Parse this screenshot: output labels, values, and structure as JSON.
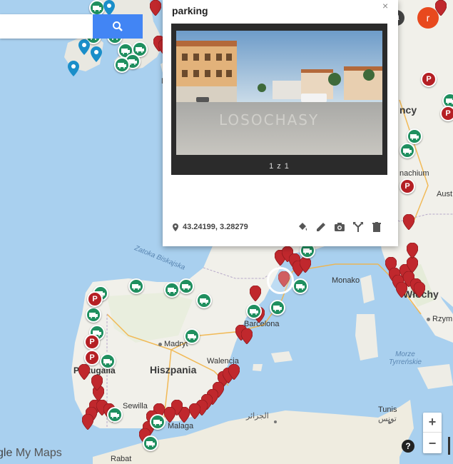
{
  "search": {
    "placeholder": "",
    "button_icon": "search-icon"
  },
  "topbar": {
    "apps_icon": "apps-grid-icon",
    "notifications_icon": "bell-icon",
    "avatar_letter": "r"
  },
  "popup": {
    "title": "parking",
    "close_label": "×",
    "photo_counter": "1 z 1",
    "photo_watermark": "LOSOCHASY",
    "coordinates": "43.24199, 3.28279",
    "tools": [
      "paint-bucket-icon",
      "pencil-icon",
      "camera-icon",
      "directions-icon",
      "trash-icon"
    ]
  },
  "map": {
    "labels": {
      "spain": "Hiszpania",
      "italy": "Włochy",
      "portugal": "Portugalia",
      "france_fragment": "ncy",
      "austria_fragment": "Aust",
      "bay_of_biscay": "Zatoka Biskajska",
      "tyrrhenian": "Morze\nTyrreńskie",
      "madrid": "Madryt",
      "barcelona": "Barcelona",
      "valencia": "Walencja",
      "sevilla": "Sewilla",
      "malaga": "Malaga",
      "monaco": "Monako",
      "rome": "Rzym",
      "tunis_latin": "Tunis",
      "tunis_arabic": "تونس",
      "algiers_arabic": "الجزائر",
      "rabat": "Rabat",
      "munich_fragment": "nachium",
      "ma_fragment": "Ma"
    }
  },
  "zoom": {
    "in": "+",
    "out": "−"
  },
  "help": "?",
  "logo": {
    "prefix": "gle",
    "suffix": "My Maps"
  }
}
